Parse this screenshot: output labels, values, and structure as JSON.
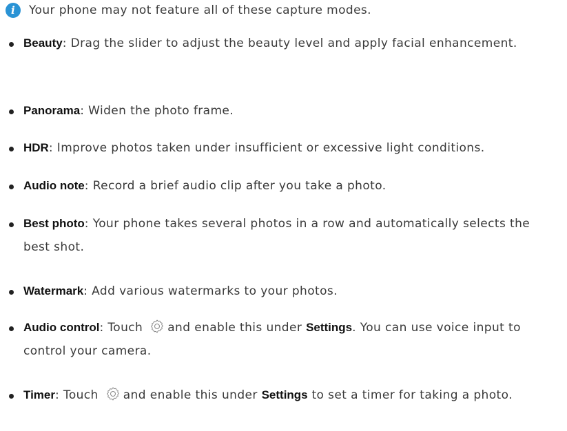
{
  "note": {
    "text": "Your phone may not feature all of these capture modes."
  },
  "items": [
    {
      "term": "Beauty",
      "description": ": Drag the slider to adjust the beauty level and apply facial enhancement."
    },
    {
      "term": "Panorama",
      "description": ": Widen the photo frame."
    },
    {
      "term": "HDR",
      "description": ": Improve photos taken under insufficient or excessive light conditions."
    },
    {
      "term": "Audio note",
      "description": ": Record a brief audio clip after you take a photo."
    },
    {
      "term": "Best photo",
      "description": ": Your phone takes several photos in a row and automatically selects the best shot."
    },
    {
      "term": "Watermark",
      "description": ": Add various watermarks to your photos."
    },
    {
      "term": "Audio control",
      "pre": ": Touch",
      "mid": "and enable this under",
      "bold": "Settings",
      "post": ". You can use voice input to control your camera.",
      "icon": "settings-gear-icon"
    },
    {
      "term": "Timer",
      "pre": ": Touch",
      "mid": "and enable this under",
      "bold": "Settings",
      "post": "to set a timer for taking a photo.",
      "icon": "settings-gear-icon"
    }
  ]
}
